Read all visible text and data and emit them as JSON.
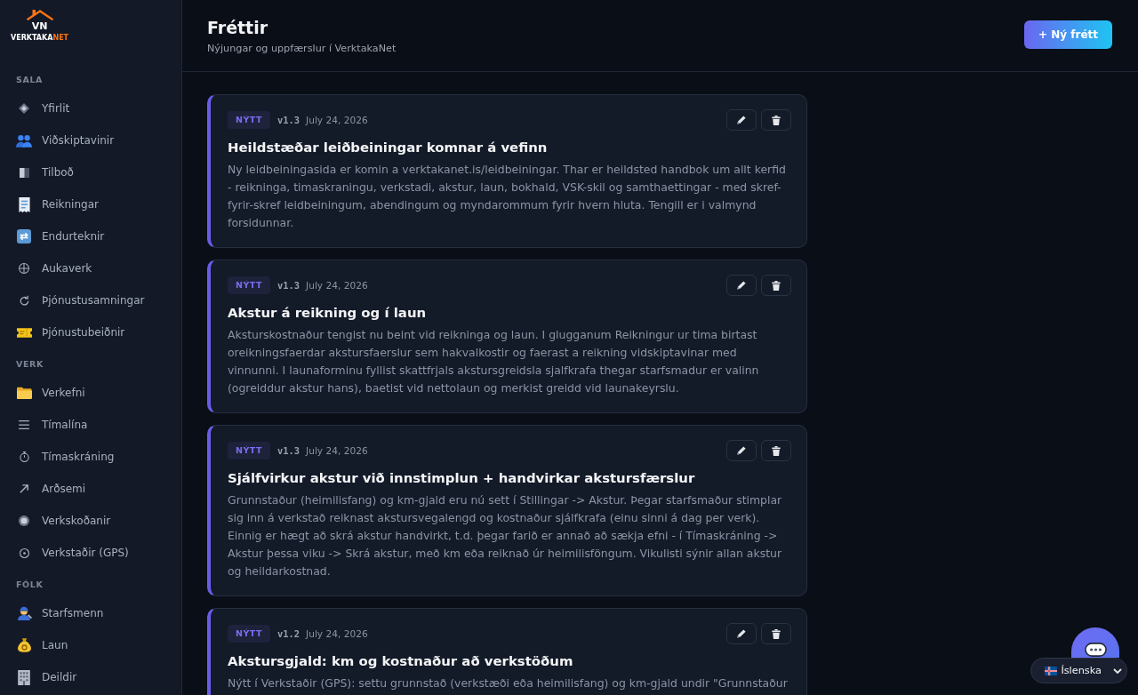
{
  "sidebar": {
    "logo": {
      "monogram": "VN",
      "wordmark_parts": [
        "VERKTAKA",
        "NET"
      ]
    },
    "sections": [
      {
        "label": "SALA",
        "items": [
          {
            "label": "Yfirlit",
            "selected": false
          },
          {
            "label": "Viðskiptavinir",
            "selected": false
          },
          {
            "label": "Tilboð",
            "selected": false
          },
          {
            "label": "Reikningar",
            "selected": false
          },
          {
            "label": "Endurteknir",
            "selected": false
          },
          {
            "label": "Aukaverk",
            "selected": false
          },
          {
            "label": "Þjónustusamningar",
            "selected": false
          },
          {
            "label": "Þjónustubeiðnir",
            "selected": false
          }
        ]
      },
      {
        "label": "VERK",
        "items": [
          {
            "label": "Verkefni",
            "selected": false
          },
          {
            "label": "Tímalína",
            "selected": false
          },
          {
            "label": "Tímaskráning",
            "selected": false
          },
          {
            "label": "Arðsemi",
            "selected": false
          },
          {
            "label": "Verkskoðanir",
            "selected": false
          },
          {
            "label": "Verkstaðir (GPS)",
            "selected": false
          }
        ]
      },
      {
        "label": "FÓLK",
        "items": [
          {
            "label": "Starfsmenn",
            "selected": false
          },
          {
            "label": "Laun",
            "selected": false
          },
          {
            "label": "Deildir",
            "selected": false
          }
        ]
      }
    ]
  },
  "header": {
    "title": "Fréttir",
    "subtitle": "Nýjungar og uppfærslur í VerktakaNet",
    "new_button": "+ Ný frétt"
  },
  "news": [
    {
      "tag": "NÝTT",
      "version": "v1.3",
      "date": "July 24, 2026",
      "title": "Heildstæðar leiðbeiningar komnar á vefinn",
      "body": "Ny leidbeiningasida er komin a verktakanet.is/leidbeiningar. Thar er heildsted handbok um allt kerfid - reikninga, timaskraningu, verkstadi, akstur, laun, bokhald, VSK-skil og samthaettingar - med skref-fyrir-skref leidbeiningum, abendingum og myndarommum fyrir hvern hluta. Tengill er i valmynd forsidunnar."
    },
    {
      "tag": "NÝTT",
      "version": "v1.3",
      "date": "July 24, 2026",
      "title": "Akstur á reikning og í laun",
      "body": "Aksturskostnaður tengist nu beint vid reikninga og laun. I glugganum Reikningur ur tima birtast oreikningsfaerdar akstursfaerslur sem hakvalkostir og faerast a reikning vidskiptavinar med vinnunni. I launaforminu fyllist skattfrjals akstursgreidsla sjalfkrafa thegar starfsmadur er valinn (ogreiddur akstur hans), baetist vid nettolaun og merkist greidd vid launakeyrslu."
    },
    {
      "tag": "NÝTT",
      "version": "v1.3",
      "date": "July 24, 2026",
      "title": "Sjálfvirkur akstur við innstimplun + handvirkar akstursfærslur",
      "body": "Grunnstaður (heimilisfang) og km-gjald eru nú sett í Stillingar -> Akstur. Þegar starfsmaður stimplar sig inn á verkstað reiknast akstursvegalengd og kostnaður sjálfkrafa (einu sinni á dag per verk). Einnig er hægt að skrá akstur handvirkt, t.d. þegar farið er annað að sækja efni - í Tímaskráning -> Akstur þessa viku -> Skrá akstur, með km eða reiknað úr heimilisföngum. Vikulisti sýnir allan akstur og heildarkostnad."
    },
    {
      "tag": "NÝTT",
      "version": "v1.2",
      "date": "July 24, 2026",
      "title": "Akstursgjald: km og kostnaður að verkstöðum",
      "body": "Nýtt í Verkstaðir (GPS): settu grunnstað (verkstæði eða heimilisfang) og km-gjald undir \"Grunnstaður"
    }
  ],
  "language_select": {
    "value": "Íslenska"
  }
}
